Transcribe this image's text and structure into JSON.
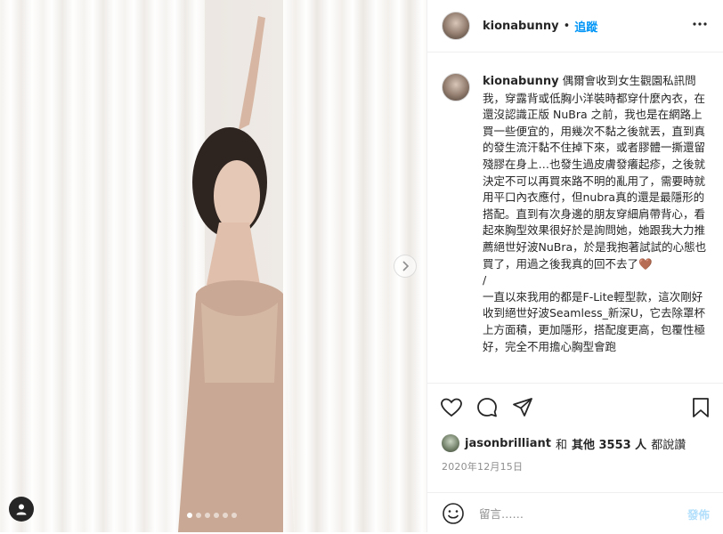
{
  "post": {
    "username": "kionabunny",
    "separator": "•",
    "follow_label": "追蹤",
    "caption": "偶爾會收到女生觀園私訊問我，穿露背或低胸小洋裝時都穿什麼內衣，在還沒認識正版 NuBra 之前，我也是在網路上買一些便宜的，用幾次不黏之後就丟，直到真的發生流汗黏不住掉下來，或者膠體一撕還留殘膠在身上…也發生過皮膚發癢起疹，之後就決定不可以再買來路不明的亂用了，需要時就用平口內衣應付，但nubra真的還是最隱形的搭配。直到有次身邊的朋友穿細肩帶背心，看起來胸型效果很好於是詢問她，她跟我大力推薦絕世好波NuBra，於是我抱著試試的心態也買了，用過之後我真的回不去了🤎\n/\n一直以來我用的都是F-Lite輕型款，這次剛好收到絕世好波Seamless_新深U，它去除罩杯上方面積，更加隱形，搭配度更高，包覆性極好，完全不用擔心胸型會跑"
  },
  "likes": {
    "liker": "jasonbrilliant",
    "connector": "和",
    "others": "其他 3553 人",
    "suffix": "都說讚"
  },
  "date": "2020年12月15日",
  "comment": {
    "placeholder": "留言……",
    "post_label": "發佈"
  },
  "carousel": {
    "total_slides": 6,
    "active_slide": 1
  },
  "icons": {
    "more": "more-horizontal-icon",
    "like": "heart-icon",
    "comment": "comment-bubble-icon",
    "share": "paper-plane-icon",
    "save": "bookmark-icon",
    "emoji": "emoji-smile-icon",
    "next": "chevron-right-icon",
    "tags": "user-tag-icon"
  },
  "colors": {
    "accent": "#0095f6",
    "post_disabled": "#b2dffc",
    "text": "#262626",
    "muted": "#8e8e8e"
  }
}
